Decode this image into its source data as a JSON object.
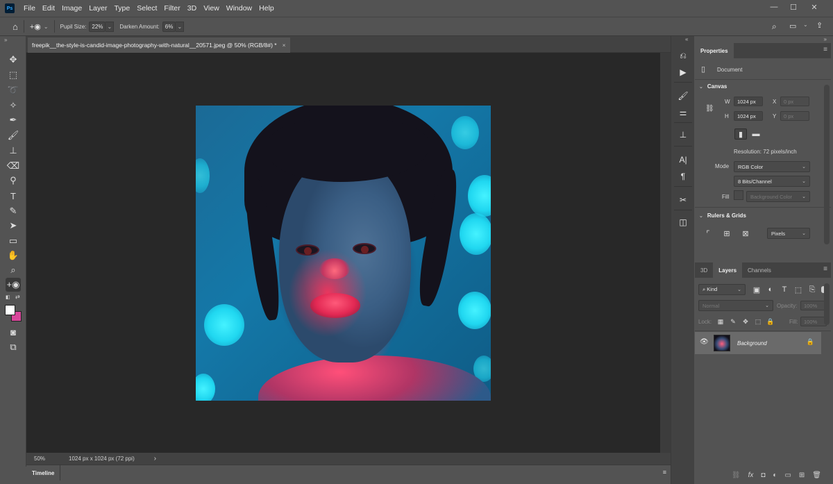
{
  "app": {
    "logo_text": "Ps",
    "menu": [
      "File",
      "Edit",
      "Image",
      "Layer",
      "Type",
      "Select",
      "Filter",
      "3D",
      "View",
      "Window",
      "Help"
    ],
    "window_controls": {
      "minimize": "—",
      "maximize": "☐",
      "close": "✕"
    }
  },
  "options_bar": {
    "pupil_size_label": "Pupil Size:",
    "pupil_size_value": "22%",
    "darken_amount_label": "Darken Amount:",
    "darken_amount_value": "6%"
  },
  "document": {
    "tab_title": "freepik__the-style-is-candid-image-photography-with-natural__20571.jpeg @ 50% (RGB/8#) *",
    "close_glyph": "×"
  },
  "status_bar": {
    "zoom": "50%",
    "doc_info": "1024 px x 1024 px (72 ppi)",
    "arrow": "›"
  },
  "timeline": {
    "label": "Timeline"
  },
  "properties": {
    "tab": "Properties",
    "document_label": "Document",
    "canvas_section": "Canvas",
    "w_label": "W",
    "w_value": "1024 px",
    "h_label": "H",
    "h_value": "1024 px",
    "x_label": "X",
    "x_value": "0 px",
    "y_label": "Y",
    "y_value": "0 px",
    "resolution": "Resolution: 72 pixels/inch",
    "mode_label": "Mode",
    "mode_value": "RGB Color",
    "bits_value": "8 Bits/Channel",
    "fill_label": "Fill",
    "fill_value": "Background Color",
    "rulers_section": "Rulers & Grids",
    "units_value": "Pixels"
  },
  "layers": {
    "tabs": [
      "3D",
      "Layers",
      "Channels"
    ],
    "kind_placeholder": "Kind",
    "blend_mode": "Normal",
    "opacity_label": "Opacity:",
    "opacity_value": "100%",
    "lock_label": "Lock:",
    "fill_label": "Fill:",
    "fill_value": "100%",
    "layer_name": "Background"
  },
  "colors": {
    "ui_bg": "#535353",
    "canvas_bg": "#282828",
    "foreground_swatch": "#ffffff",
    "background_swatch": "#d9479b"
  }
}
